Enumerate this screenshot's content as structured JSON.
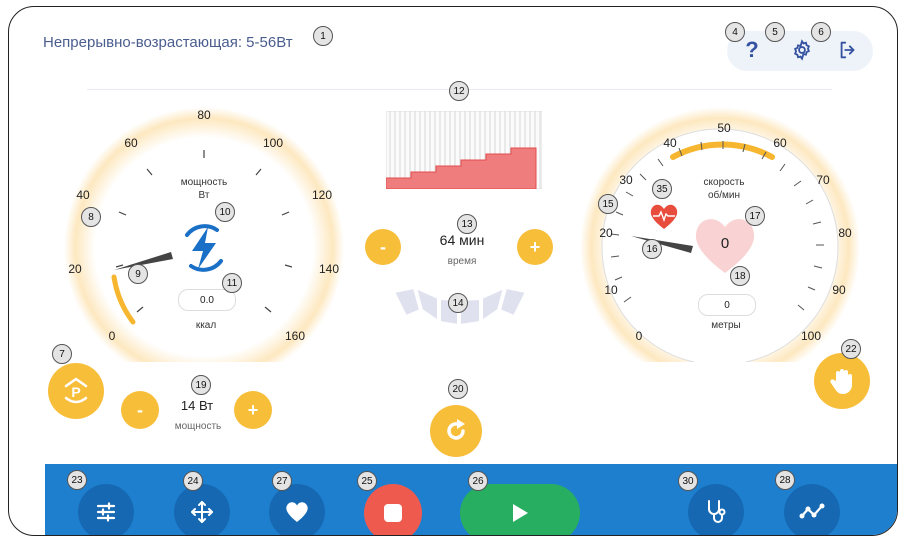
{
  "header": {
    "title": "Непрерывно-возрастающая: 5-56Вт",
    "help_glyph": "?",
    "settings_icon": "gear-icon",
    "exit_icon": "logout-icon"
  },
  "badges": [
    "1",
    "4",
    "5",
    "6",
    "7",
    "8",
    "9",
    "10",
    "11",
    "12",
    "13",
    "14",
    "15",
    "16",
    "17",
    "18",
    "19",
    "20",
    "22",
    "23",
    "24",
    "25",
    "26",
    "27",
    "28",
    "30",
    "35"
  ],
  "power_dial": {
    "label": "мощность",
    "unit": "Вт",
    "ticks": [
      "0",
      "20",
      "40",
      "60",
      "80",
      "100",
      "120",
      "140",
      "160"
    ],
    "calories_value": "0.0",
    "calories_label": "ккал",
    "needle_value": 22
  },
  "time_panel": {
    "value": "64 мин",
    "label": "время",
    "minus": "-",
    "plus": "+"
  },
  "power_control": {
    "value": "14 Вт",
    "label": "мощность",
    "minus": "-",
    "plus": "+"
  },
  "speed_dial": {
    "label": "скорость",
    "unit": "об/мин",
    "ticks": [
      "0",
      "10",
      "20",
      "30",
      "40",
      "50",
      "60",
      "70",
      "80",
      "90",
      "100"
    ],
    "heart_value": "0",
    "meters_value": "0",
    "meters_label": "метры",
    "needle_value": 21
  },
  "program_profile": {
    "steps": [
      1,
      2,
      3,
      4,
      5,
      6
    ]
  },
  "bottom_bar": {
    "buttons": [
      "sliders-icon",
      "move-icon",
      "heart-icon",
      "stop-icon",
      "play-icon",
      "stethoscope-icon",
      "graph-icon"
    ]
  },
  "colors": {
    "accent": "#f7be3a",
    "primary": "#1f7fcf",
    "stop": "#ef5a4e",
    "play": "#27ae60",
    "chart_fill": "#f07d7d"
  }
}
